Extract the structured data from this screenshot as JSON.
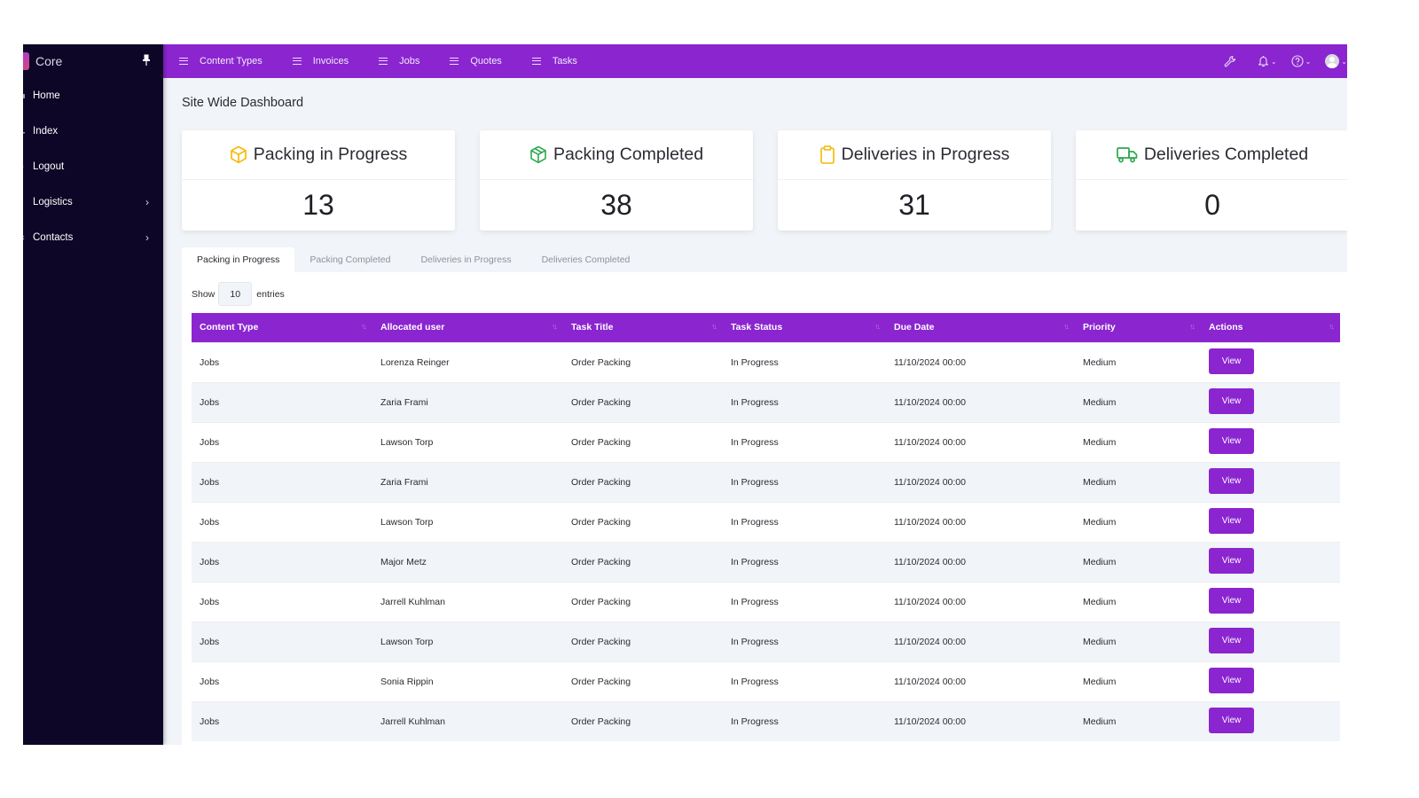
{
  "sidebar": {
    "brand": "Core",
    "items": [
      {
        "label": "Home",
        "has_children": false
      },
      {
        "label": "Index",
        "has_children": false
      },
      {
        "label": "Logout",
        "has_children": false
      },
      {
        "label": "Logistics",
        "has_children": true
      },
      {
        "label": "Contacts",
        "has_children": true
      }
    ]
  },
  "topbar": {
    "links": [
      "Content Types",
      "Invoices",
      "Jobs",
      "Quotes",
      "Tasks"
    ],
    "icons": [
      "wrench-icon",
      "bell-icon",
      "help-icon",
      "user-avatar"
    ]
  },
  "page": {
    "title": "Site Wide Dashboard"
  },
  "cards": [
    {
      "label": "Packing in Progress",
      "value": "13",
      "icon": "box-icon",
      "color": "#f5b800"
    },
    {
      "label": "Packing Completed",
      "value": "38",
      "icon": "box-check-icon",
      "color": "#2ea84f"
    },
    {
      "label": "Deliveries in Progress",
      "value": "31",
      "icon": "clipboard-icon",
      "color": "#f5b800"
    },
    {
      "label": "Deliveries Completed",
      "value": "0",
      "icon": "truck-icon",
      "color": "#2ea84f"
    }
  ],
  "tabs": [
    "Packing in Progress",
    "Packing Completed",
    "Deliveries in Progress",
    "Deliveries Completed"
  ],
  "active_tab": 0,
  "table": {
    "show_label": "Show",
    "entries_label": "entries",
    "page_length": "10",
    "columns": [
      "Content Type",
      "Allocated user",
      "Task Title",
      "Task Status",
      "Due Date",
      "Priority",
      "Actions"
    ],
    "action_label": "View",
    "rows": [
      [
        "Jobs",
        "Lorenza Reinger",
        "Order Packing",
        "In Progress",
        "11/10/2024 00:00",
        "Medium"
      ],
      [
        "Jobs",
        "Zaria Frami",
        "Order Packing",
        "In Progress",
        "11/10/2024 00:00",
        "Medium"
      ],
      [
        "Jobs",
        "Lawson Torp",
        "Order Packing",
        "In Progress",
        "11/10/2024 00:00",
        "Medium"
      ],
      [
        "Jobs",
        "Zaria Frami",
        "Order Packing",
        "In Progress",
        "11/10/2024 00:00",
        "Medium"
      ],
      [
        "Jobs",
        "Lawson Torp",
        "Order Packing",
        "In Progress",
        "11/10/2024 00:00",
        "Medium"
      ],
      [
        "Jobs",
        "Major Metz",
        "Order Packing",
        "In Progress",
        "11/10/2024 00:00",
        "Medium"
      ],
      [
        "Jobs",
        "Jarrell Kuhlman",
        "Order Packing",
        "In Progress",
        "11/10/2024 00:00",
        "Medium"
      ],
      [
        "Jobs",
        "Lawson Torp",
        "Order Packing",
        "In Progress",
        "11/10/2024 00:00",
        "Medium"
      ],
      [
        "Jobs",
        "Sonia Rippin",
        "Order Packing",
        "In Progress",
        "11/10/2024 00:00",
        "Medium"
      ],
      [
        "Jobs",
        "Jarrell Kuhlman",
        "Order Packing",
        "In Progress",
        "11/10/2024 00:00",
        "Medium"
      ]
    ]
  },
  "colors": {
    "accent": "#8a25d0",
    "sidebar": "#0d0626",
    "content_bg": "#f1f4f8",
    "warning": "#f5b800",
    "success": "#2ea84f"
  }
}
